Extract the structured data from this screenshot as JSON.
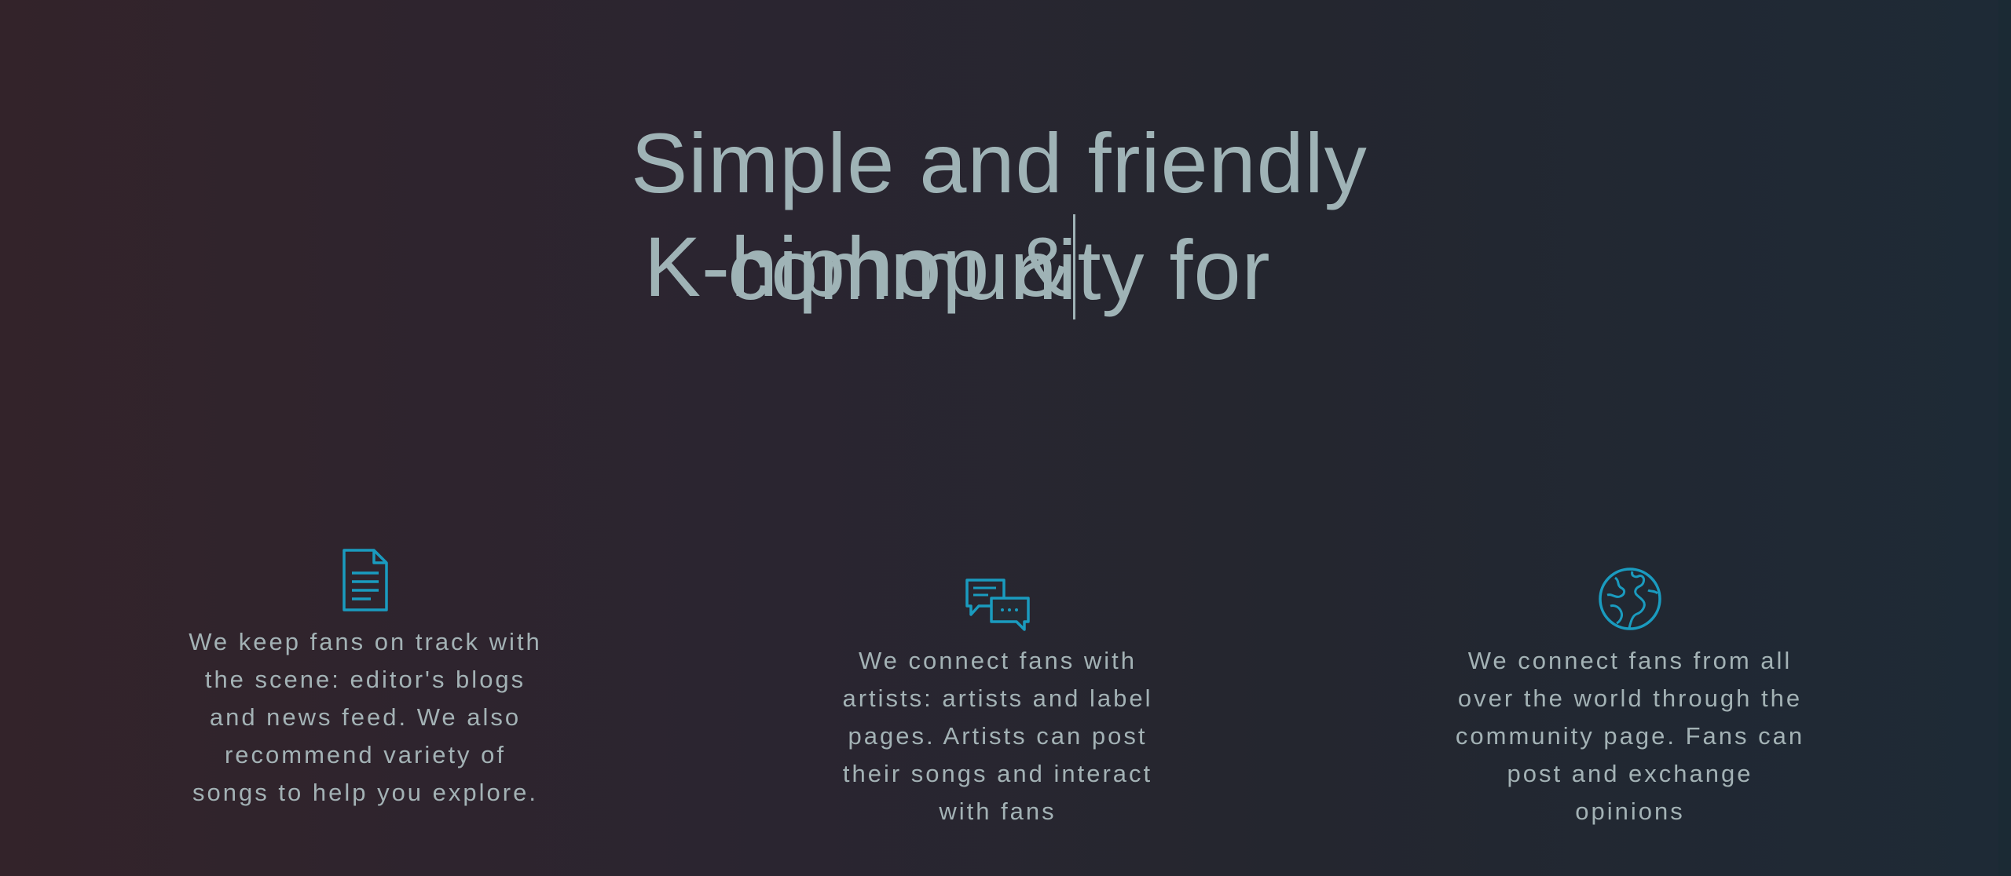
{
  "hero": {
    "line1": "Simple and friendly",
    "line2": "community for",
    "typing": "K-hiphop &"
  },
  "features": [
    {
      "icon": "document-icon",
      "text": "We keep fans on track with the scene: editor's blogs and news feed. We also recommend variety of songs to help you explore."
    },
    {
      "icon": "chat-bubbles-icon",
      "text": "We connect fans with artists: artists and label pages. Artists can post their songs and interact with fans"
    },
    {
      "icon": "globe-icon",
      "text": "We connect fans from all over the world through the community page. Fans can post and exchange opinions"
    }
  ],
  "colors": {
    "accent": "#1a9bbf",
    "text": "#9fb3b6",
    "background_left": "#33232a",
    "background_right": "#1e2a36"
  }
}
